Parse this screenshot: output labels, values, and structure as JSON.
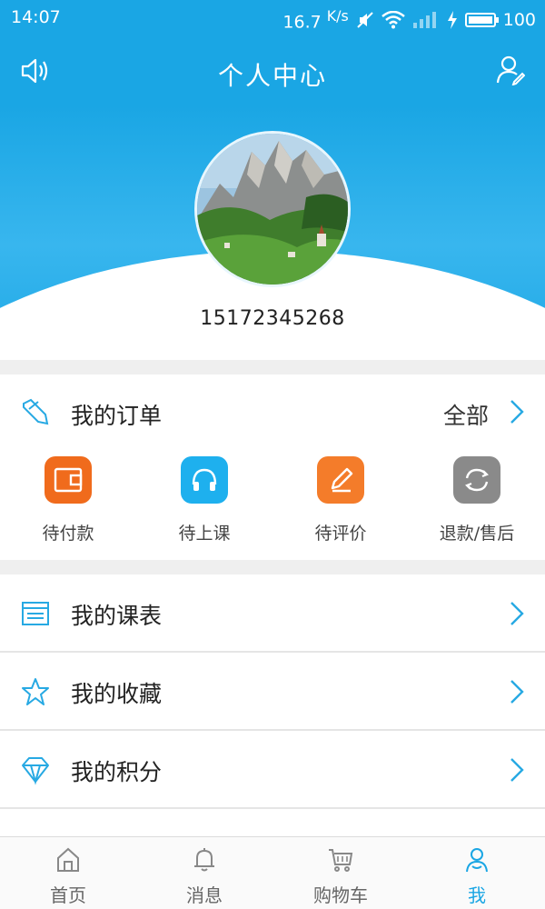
{
  "status_bar": {
    "time": "14:07",
    "speed": "16.7",
    "speed_unit": "K/s",
    "battery": "100",
    "battery_level_percent": 100
  },
  "header": {
    "title": "个人中心"
  },
  "profile": {
    "phone": "15172345268"
  },
  "orders": {
    "label": "我的订单",
    "all_label": "全部",
    "items": [
      {
        "label": "待付款",
        "icon": "wallet-icon",
        "color": "#f06b1c"
      },
      {
        "label": "待上课",
        "icon": "headphones-icon",
        "color": "#1eb0ee"
      },
      {
        "label": "待评价",
        "icon": "pencil-icon",
        "color": "#f47c2a"
      },
      {
        "label": "退款/售后",
        "icon": "refresh-icon",
        "color": "#8a8a8a"
      }
    ]
  },
  "menu": {
    "items": [
      {
        "label": "我的课表",
        "icon": "schedule-icon"
      },
      {
        "label": "我的收藏",
        "icon": "star-icon"
      },
      {
        "label": "我的积分",
        "icon": "diamond-icon"
      }
    ]
  },
  "tabbar": {
    "items": [
      {
        "label": "首页",
        "icon": "home-icon",
        "active": false
      },
      {
        "label": "消息",
        "icon": "bell-icon",
        "active": false
      },
      {
        "label": "购物车",
        "icon": "cart-icon",
        "active": false
      },
      {
        "label": "我",
        "icon": "user-icon",
        "active": true
      }
    ]
  },
  "colors": {
    "accent": "#1aa6e4",
    "icon_stroke": "#27a9e3"
  }
}
